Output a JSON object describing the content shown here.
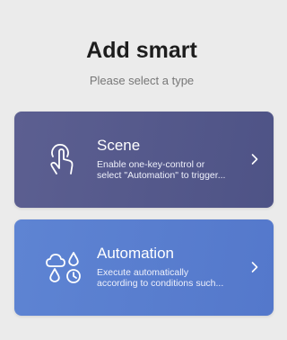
{
  "header": {
    "title": "Add smart",
    "subtitle": "Please select a type"
  },
  "cards": [
    {
      "title": "Scene",
      "desc_line1": "Enable one-key-control or",
      "desc_line2": "select \"Automation\" to trigger...",
      "icon": "tap-hand-icon",
      "color": "#545889"
    },
    {
      "title": "Automation",
      "desc_line1": "Execute automatically",
      "desc_line2": "according to conditions such...",
      "icon": "weather-clock-icon",
      "color": "#597ece"
    }
  ],
  "icons": {
    "chevron": "chevron-right-icon"
  }
}
